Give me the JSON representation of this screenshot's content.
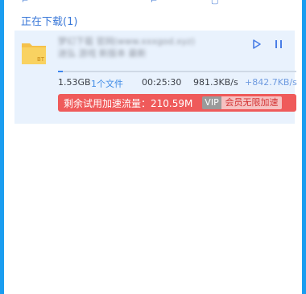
{
  "section": {
    "title": "正在下载(1)"
  },
  "task": {
    "name_blurred": "梦幻下载 官网(www.xxxgod.xyz)迷弘 游戏 新版本 最新",
    "size": "1.53GB",
    "file_count": "1个文件",
    "time_left": "00:25:30",
    "speed": "981.3KB/s",
    "speed_boost": "+842.7KB/s",
    "progress": 0.02,
    "file_badge": "BT"
  },
  "banner": {
    "trial_label": "剩余试用加速流量：210.59M",
    "vip_badge": "VIP",
    "vip_cta": "会员无限加速"
  },
  "colors": {
    "frame": "#1a9df0",
    "row_bg": "#e9f2fd",
    "banner": "#ef5a5a",
    "accent": "#3d86f0"
  }
}
